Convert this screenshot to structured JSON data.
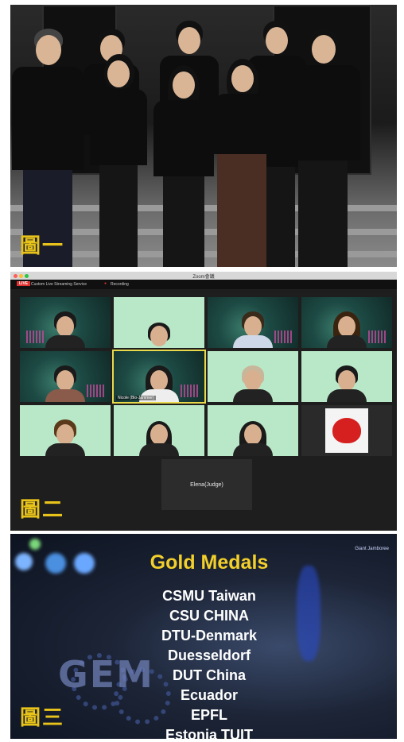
{
  "panels": [
    {
      "caption_char": "圖",
      "caption_suffix": "一"
    },
    {
      "caption_char": "圖",
      "caption_suffix": "二"
    },
    {
      "caption_char": "圖",
      "caption_suffix": "三"
    }
  ],
  "zoom": {
    "window_title": "Zoom會議",
    "live_badge": "LIVE",
    "live_label": "Custom Live Streaming Service",
    "recording_label": "Recording",
    "highlighted_tile_name": "Nicole (Bio-Jammer)",
    "elena_tile_label": "Elena(Judge)"
  },
  "medals": {
    "title": "Gold Medals",
    "teams": [
      "CSMU Taiwan",
      "CSU CHINA",
      "DTU-Denmark",
      "Duesseldorf",
      "DUT China",
      "Ecuador",
      "EPFL",
      "Estonia TUIT"
    ],
    "logo_text": "GEM",
    "badge_text": "Giant Jamboree",
    "colors": {
      "title": "#f2cf2a",
      "caption": "#e8c31a"
    }
  }
}
